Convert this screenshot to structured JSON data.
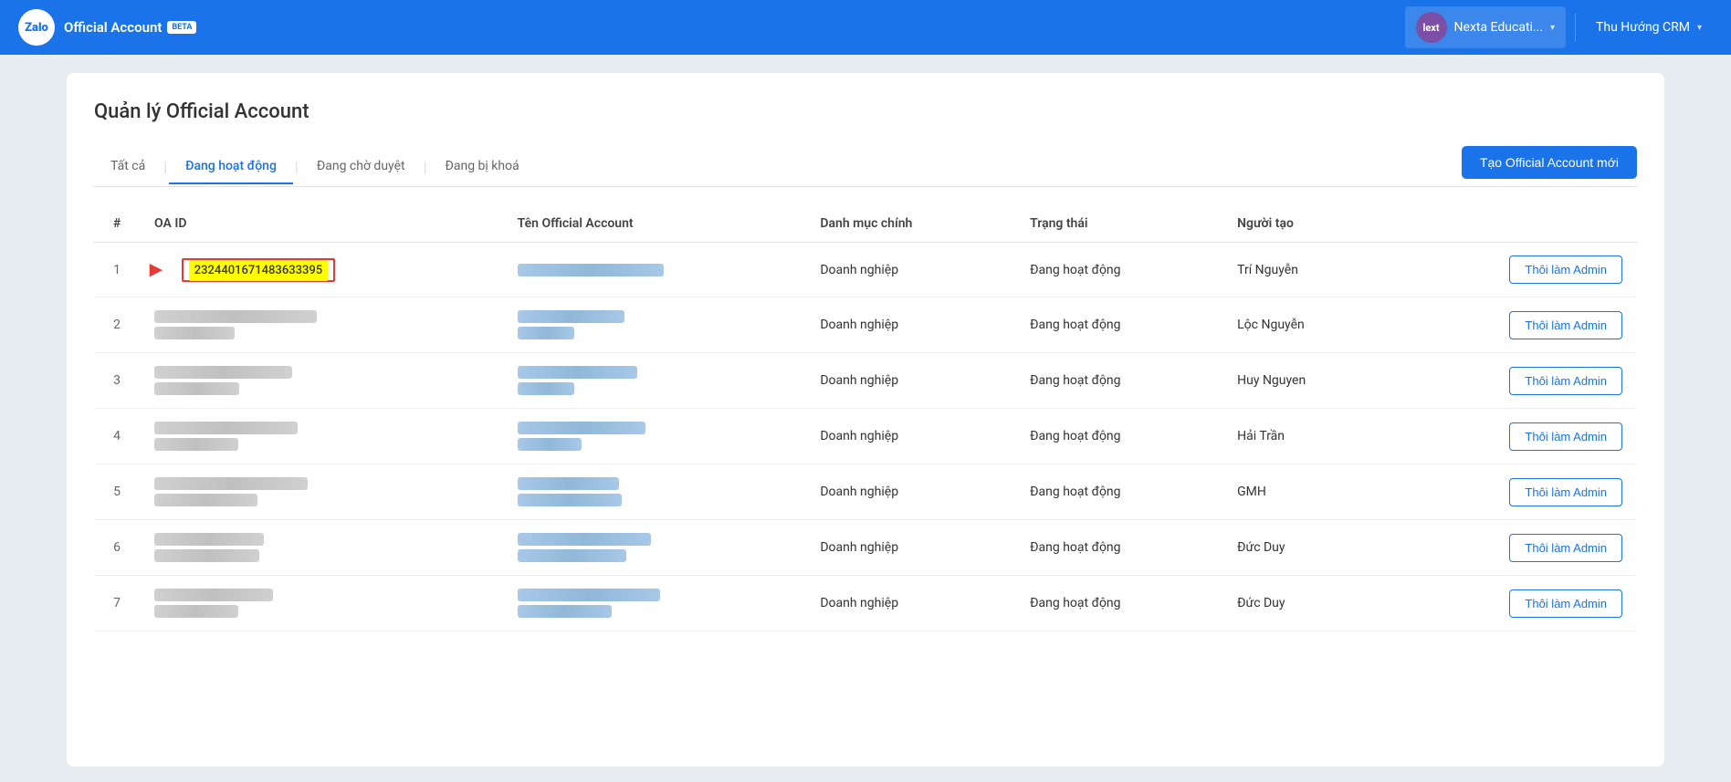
{
  "header": {
    "logo_text": "Zalo",
    "brand_text": "Official Account",
    "beta_label": "BETA",
    "nexta_label": "Nexta Educati...",
    "user_label": "Thu Hướng CRM",
    "nexta_initials": "lext"
  },
  "page": {
    "title": "Quản lý Official Account"
  },
  "tabs": {
    "all": "Tất cả",
    "active": "Đang hoạt động",
    "pending": "Đang chờ duyệt",
    "locked": "Đang bị khoá"
  },
  "create_button": "Tạo Official Account mới",
  "table": {
    "headers": {
      "num": "#",
      "oa_id": "OA ID",
      "oa_name": "Tên Official Account",
      "category": "Danh mục chính",
      "status": "Trạng thái",
      "creator": "Người tạo"
    },
    "rows": [
      {
        "num": "1",
        "oa_id": "2324401671483633395",
        "oa_id_highlight": true,
        "category": "Doanh nghiệp",
        "status": "Đang hoạt động",
        "creator": "Trí Nguyễn",
        "action": "Thôi làm Admin"
      },
      {
        "num": "2",
        "oa_id": "",
        "category": "Doanh nghiệp",
        "status": "Đang hoạt động",
        "creator": "Lộc Nguyễn",
        "action": "Thôi làm Admin"
      },
      {
        "num": "3",
        "oa_id": "",
        "category": "Doanh nghiệp",
        "status": "Đang hoạt động",
        "creator": "Huy Nguyen",
        "action": "Thôi làm Admin"
      },
      {
        "num": "4",
        "oa_id": "",
        "category": "Doanh nghiệp",
        "status": "Đang hoạt động",
        "creator": "Hải Trần",
        "action": "Thôi làm Admin"
      },
      {
        "num": "5",
        "oa_id": "",
        "category": "Doanh nghiệp",
        "status": "Đang hoạt động",
        "creator": "GMH",
        "action": "Thôi làm Admin"
      },
      {
        "num": "6",
        "oa_id": "",
        "category": "Doanh nghiệp",
        "status": "Đang hoạt động",
        "creator": "Đức Duy",
        "action": "Thôi làm Admin"
      },
      {
        "num": "7",
        "oa_id": "",
        "category": "Doanh nghiệp",
        "status": "Đang hoạt động",
        "creator": "Đức Duy",
        "action": "Thôi làm Admin"
      }
    ]
  }
}
